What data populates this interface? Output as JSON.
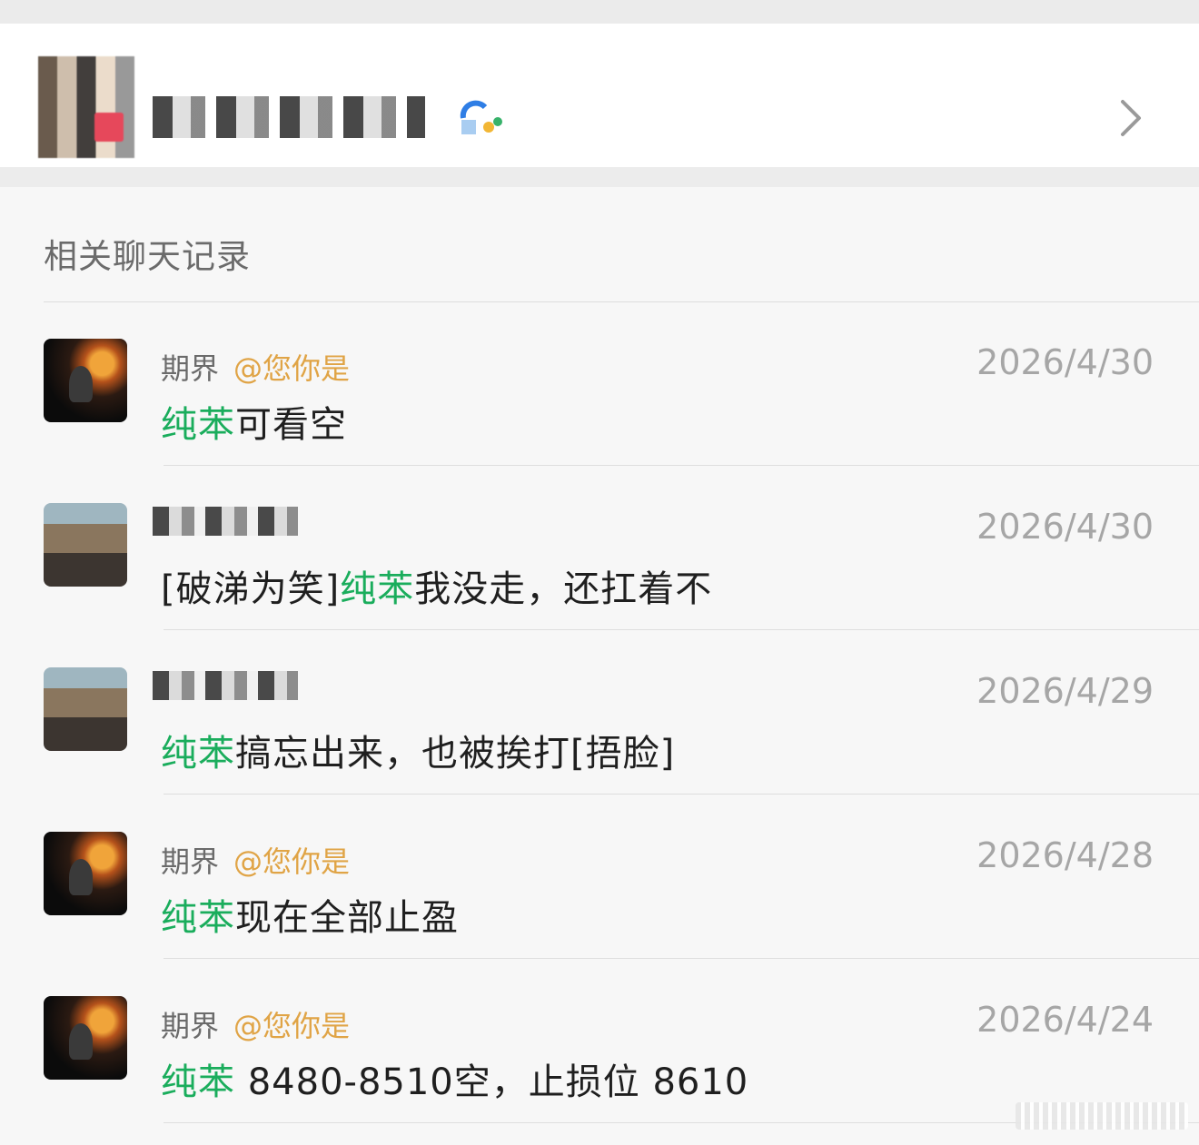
{
  "header": {
    "contact_name_masked": true,
    "badge_icon": "app-badge-icon",
    "chevron_icon": "chevron-right-icon"
  },
  "section": {
    "title": "相关聊天记录"
  },
  "results": [
    {
      "sender": "期界",
      "mention": "@您你是",
      "date": "2026/4/30",
      "pre": "",
      "keyword": "纯苯",
      "post": "可看空",
      "sender_masked": false
    },
    {
      "sender": "",
      "mention": "",
      "date": "2026/4/30",
      "pre": "[破涕为笑]",
      "keyword": "纯苯",
      "post": "我没走，还扛着不",
      "sender_masked": true
    },
    {
      "sender": "",
      "mention": "",
      "date": "2026/4/29",
      "pre": "",
      "keyword": "纯苯",
      "post": "搞忘出来，也被挨打[捂脸]",
      "sender_masked": true
    },
    {
      "sender": "期界",
      "mention": "@您你是",
      "date": "2026/4/28",
      "pre": "",
      "keyword": "纯苯",
      "post": "现在全部止盈",
      "sender_masked": false
    },
    {
      "sender": "期界",
      "mention": "@您你是",
      "date": "2026/4/24",
      "pre": "",
      "keyword": "纯苯",
      "post": " 8480-8510空，止损位 8610",
      "sender_masked": false
    }
  ],
  "colors": {
    "keyword": "#1aad5c",
    "mention": "#e0a446",
    "date": "#a6a6a6"
  }
}
